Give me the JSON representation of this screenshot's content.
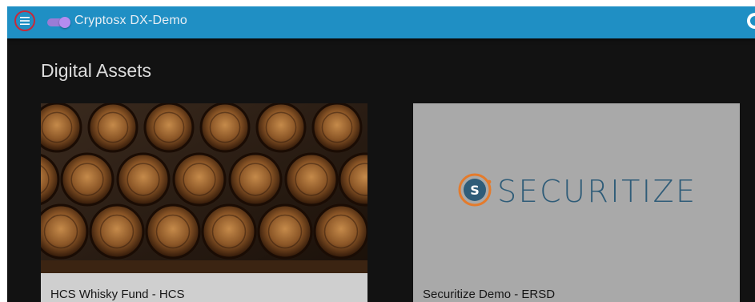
{
  "appbar": {
    "menu_icon": "menu-icon",
    "app_title": "Cryptosx DX-Demo",
    "account_icon": "account-icon",
    "colors": {
      "bar": "#1f8fc4",
      "toggle": "#b48cf0"
    }
  },
  "main": {
    "title": "Digital Assets",
    "cards": [
      {
        "label": "HCS Whisky Fund - HCS",
        "media": "whisky-barrels-photo"
      },
      {
        "label": "Securitize Demo - ERSD",
        "media": "securitize-logo",
        "logo_text": "SECURITIZE"
      }
    ]
  }
}
